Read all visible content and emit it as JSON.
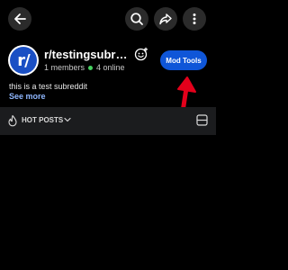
{
  "topbar": {
    "back_icon": "arrow-left-icon",
    "search_icon": "search-icon",
    "share_icon": "share-icon",
    "more_icon": "more-vertical-icon"
  },
  "subreddit": {
    "avatar_text": "r/",
    "name": "r/testingsubreddit",
    "members": "1 members",
    "online": "4 online",
    "description": "this is a test subreddit",
    "see_more": "See more",
    "mod_tools_label": "Mod Tools",
    "emoji_icon": "smiley-add-icon"
  },
  "sort": {
    "label": "HOT POSTS",
    "icon": "flame-icon"
  },
  "colors": {
    "background": "#000000",
    "accent": "#0f56d8",
    "online": "#46d160",
    "annotation": "#e3001b",
    "link": "#8fb7ff",
    "sortbar": "#1b1c1e"
  }
}
